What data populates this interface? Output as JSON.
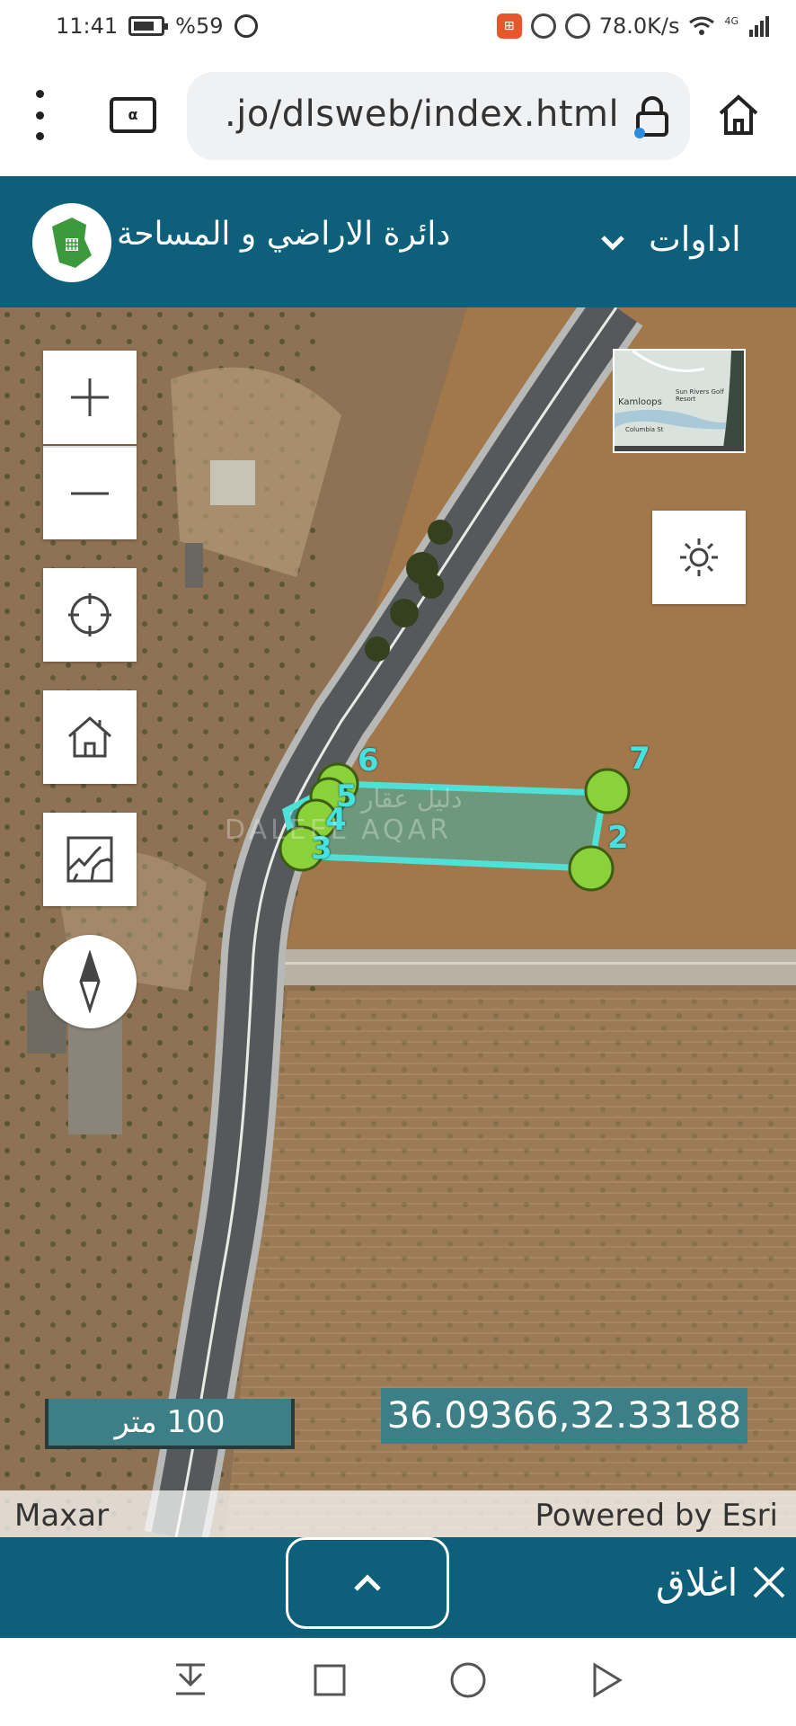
{
  "status_bar": {
    "time": "11:41",
    "battery": "%59",
    "net_speed": "78.0K/s",
    "signal_label": "4G"
  },
  "browser": {
    "url": ".jo/dlsweb/index.html",
    "tab_icon_label": "α"
  },
  "header": {
    "title": "دائرة الاراضي و المساحة",
    "tools_label": "اداوات",
    "brand_color": "#0d5f7a"
  },
  "map": {
    "scale_label": "100 متر",
    "coordinates": "36.09366,32.33188",
    "attribution_left": "Maxar",
    "attribution_right": "Powered by Esri",
    "watermark_latin": "DALEEL AQAR",
    "watermark_arabic": "دليل عقار",
    "overview": {
      "place_label": "Kamloops",
      "resort_label": "Sun Rivers Golf Resort",
      "street_label": "Columbia St"
    },
    "parcel_vertices": [
      {
        "label": "7"
      },
      {
        "label": "2"
      },
      {
        "label": "6"
      },
      {
        "label": "5"
      },
      {
        "label": "4"
      },
      {
        "label": "3"
      }
    ],
    "parcel_color": "#4fe0d8",
    "vertex_color": "#8bd23a"
  },
  "panel": {
    "close_label": "اغلاق"
  },
  "icons": {
    "zoom_in": "plus-icon",
    "zoom_out": "minus-icon",
    "locate": "crosshair-icon",
    "home": "home-icon",
    "basemap": "map-icon",
    "compass": "compass-icon",
    "daylight": "sun-icon"
  }
}
